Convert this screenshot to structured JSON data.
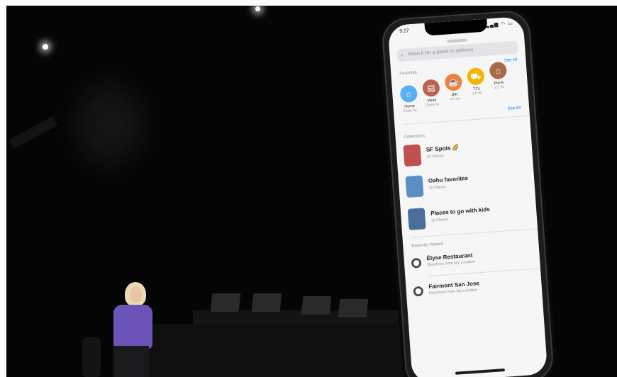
{
  "status": {
    "time": "9:27",
    "icons": "▂▄▆ ◠ ▭"
  },
  "search": {
    "placeholder": "Search for a place or address"
  },
  "favorites": {
    "label": "Favorites",
    "see_all": "See All",
    "items": [
      {
        "name": "Home",
        "sub": "Close by",
        "icon": "house-icon",
        "glyph": "⌂",
        "color": "#5ab0f0"
      },
      {
        "name": "Work",
        "sub": "Close by",
        "icon": "briefcase-icon",
        "glyph": "▤",
        "color": "#b5654f"
      },
      {
        "name": "Jhlt",
        "sub": "4.7 mi",
        "icon": "coffee-icon",
        "glyph": "☕",
        "color": "#f0803c"
      },
      {
        "name": "TJ's",
        "sub": "1.8 mi",
        "icon": "cart-icon",
        "glyph": "⛟",
        "color": "#f4b400"
      },
      {
        "name": "Pre-K",
        "sub": "2.5 mi",
        "icon": "graduation-cap-icon",
        "glyph": "⌂",
        "color": "#a86a45"
      }
    ]
  },
  "collections": {
    "label": "Collections",
    "see_all": "See All",
    "items": [
      {
        "title": "SF Spots 🌈",
        "sub": "10 Places",
        "thumb_color": "#c0504d"
      },
      {
        "title": "Oahu favorites",
        "sub": "10 Places",
        "thumb_color": "#5b8fc4"
      },
      {
        "title": "Places to go with kids",
        "sub": "11 Places",
        "thumb_color": "#4a6f9c"
      }
    ]
  },
  "recently_viewed": {
    "label": "Recently Viewed",
    "items": [
      {
        "title": "Élyse Restaurant",
        "sub": "Directions from My Location"
      },
      {
        "title": "Fairmont San Jose",
        "sub": "Directions from My Location"
      }
    ]
  }
}
